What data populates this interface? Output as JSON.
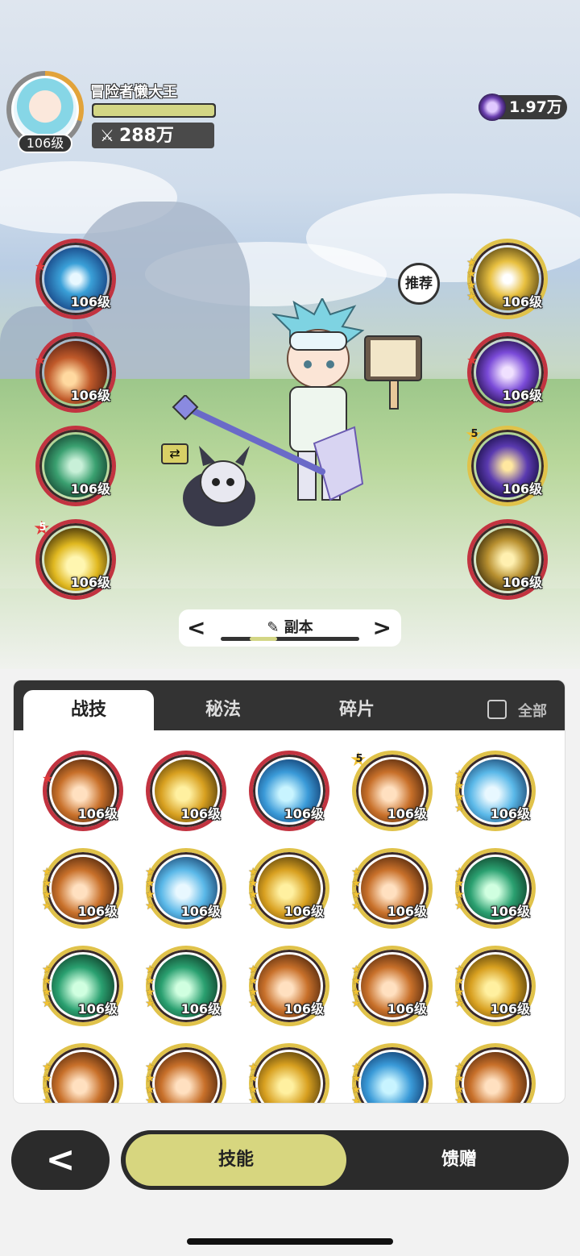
{
  "player": {
    "name": "冒险者懒大王",
    "level": "106级",
    "power": "288万",
    "hp_fraction": 1.0
  },
  "currency": {
    "amount": "1.97万",
    "icon": "purple-gem-icon"
  },
  "recommend_label": "推荐",
  "left_skills": [
    {
      "level": "106级",
      "icon": "water-vortex-icon",
      "frame": "red",
      "badge": "star"
    },
    {
      "level": "106级",
      "icon": "fire-comet-icon",
      "frame": "red",
      "badge": "star"
    },
    {
      "level": "106级",
      "icon": "wind-orb-icon",
      "frame": "red",
      "badge": ""
    },
    {
      "level": "106级",
      "icon": "lightning-orb-icon",
      "frame": "red",
      "badge": "5"
    }
  ],
  "right_skills": [
    {
      "level": "106级",
      "icon": "golden-burst-icon",
      "frame": "gold",
      "badge": "stars"
    },
    {
      "level": "106级",
      "icon": "arcane-sphere-icon",
      "frame": "red",
      "badge": "star"
    },
    {
      "level": "106级",
      "icon": "starry-night-icon",
      "frame": "gold",
      "badge": "5"
    },
    {
      "level": "106级",
      "icon": "golden-arrows-icon",
      "frame": "red",
      "badge": ""
    }
  ],
  "selector": {
    "label": "副本",
    "prev": "<",
    "next": ">"
  },
  "tabs": [
    "战技",
    "秘法",
    "碎片"
  ],
  "all_label": "全部",
  "grid_skills": [
    {
      "level": "106级",
      "icon": "flame-burst-icon",
      "frame": "red",
      "badge": "star"
    },
    {
      "level": "106级",
      "icon": "fire-swirl-icon",
      "frame": "red",
      "badge": ""
    },
    {
      "level": "106级",
      "icon": "sun-rise-icon",
      "frame": "red",
      "badge": ""
    },
    {
      "level": "106级",
      "icon": "ice-crystal-icon",
      "frame": "gold",
      "badge": "5"
    },
    {
      "level": "106级",
      "icon": "water-dragon-icon",
      "frame": "gold",
      "badge": "stars"
    },
    {
      "level": "106级",
      "icon": "green-slash-icon",
      "frame": "gold",
      "badge": "stars"
    },
    {
      "level": "106级",
      "icon": "golden-spark-icon",
      "frame": "gold",
      "badge": "stars"
    },
    {
      "level": "106级",
      "icon": "thorn-vine-icon",
      "frame": "gold",
      "badge": "stars"
    },
    {
      "level": "106级",
      "icon": "rock-shield-icon",
      "frame": "gold",
      "badge": "stars"
    },
    {
      "level": "106级",
      "icon": "heal-plus-icon",
      "frame": "gold",
      "badge": "stars"
    },
    {
      "level": "106级",
      "icon": "fire-claw-icon",
      "frame": "gold",
      "badge": "stars"
    },
    {
      "level": "106级",
      "icon": "ice-shard-icon",
      "frame": "gold",
      "badge": "stars"
    },
    {
      "level": "106级",
      "icon": "green-blade-icon",
      "frame": "gold",
      "badge": "stars"
    },
    {
      "level": "106级",
      "icon": "fire-spiral-icon",
      "frame": "gold",
      "badge": "stars"
    },
    {
      "level": "106级",
      "icon": "ice-splash-icon",
      "frame": "gold",
      "badge": "stars"
    },
    {
      "level": "",
      "icon": "teal-vortex-icon",
      "frame": "gold",
      "badge": "stars"
    },
    {
      "level": "",
      "icon": "golden-bolt-icon",
      "frame": "gold",
      "badge": "stars"
    },
    {
      "level": "",
      "icon": "lava-icon",
      "frame": "gold",
      "badge": "stars"
    },
    {
      "level": "",
      "icon": "golden-pyramid-icon",
      "frame": "gold",
      "badge": "stars"
    },
    {
      "level": "",
      "icon": "golden-star-icon",
      "frame": "gold",
      "badge": "stars"
    }
  ],
  "bottom": {
    "back": "<",
    "active_tab": "技能",
    "other_tab": "馈赠"
  },
  "colors": {
    "accent": "#d7d67f",
    "dark": "#2b2b2b",
    "red_frame": "#c23340",
    "gold_frame": "#e0c24a"
  }
}
